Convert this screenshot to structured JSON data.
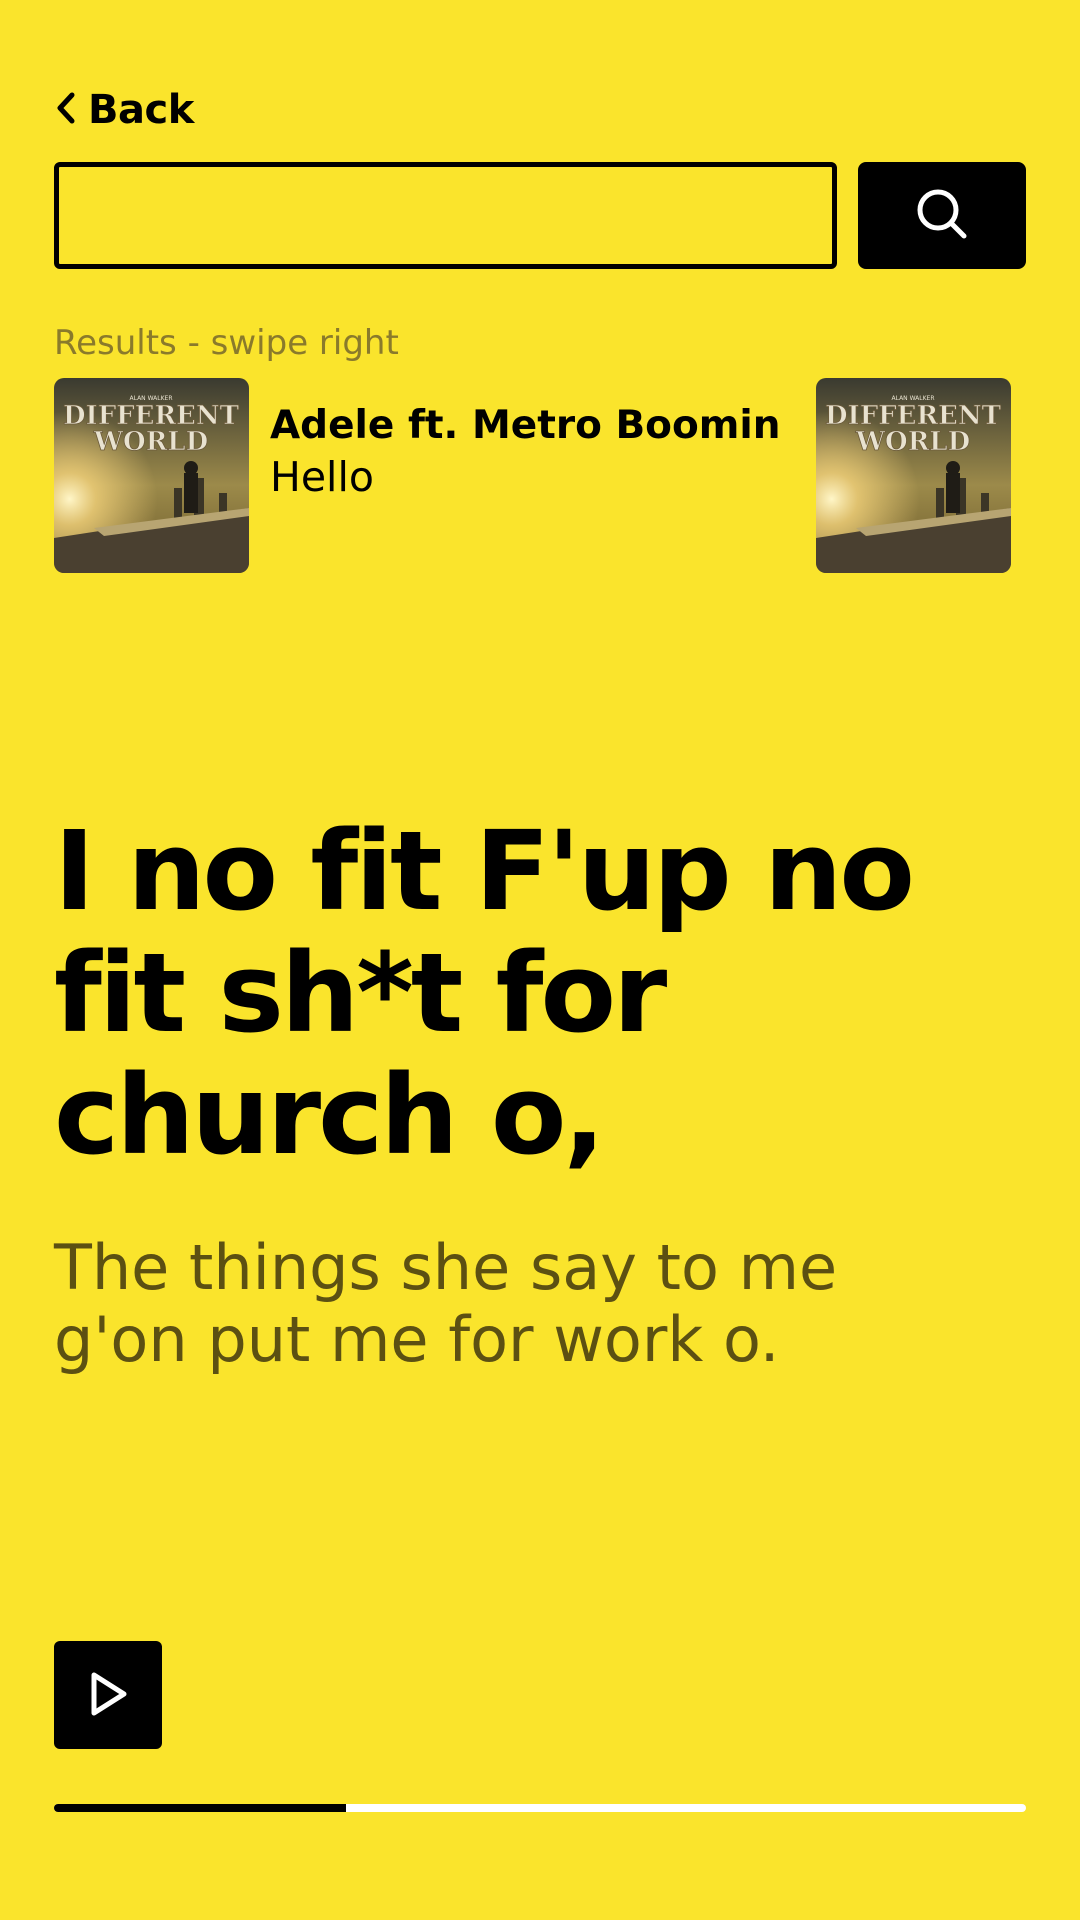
{
  "header": {
    "back_label": "Back",
    "back_icon": "chevron-left-icon"
  },
  "search": {
    "value": "",
    "placeholder": "",
    "button_icon": "search-icon"
  },
  "results": {
    "label": "Results - swipe right",
    "items": [
      {
        "artist": "Adele ft. Metro Boomin",
        "title": "Hello",
        "cover_text": [
          "DIFFERENT",
          "WORLD"
        ],
        "cover_small": "ALAN WALKER"
      },
      {
        "cover_text": [
          "DIFFERENT",
          "WORLD"
        ],
        "cover_small": "ALAN WALKER"
      }
    ]
  },
  "lyrics": {
    "current": "I no fit F'up no fit sh*t for church o,",
    "next": "The things she say to me g'on put me for work o."
  },
  "player": {
    "play_icon": "play-icon",
    "progress": 0.3
  },
  "colors": {
    "background": "#FAE42C",
    "accent": "#000000",
    "muted_text": "#8A7A2B",
    "next_lyric": "#5C5012",
    "track": "#FFFFFF"
  }
}
